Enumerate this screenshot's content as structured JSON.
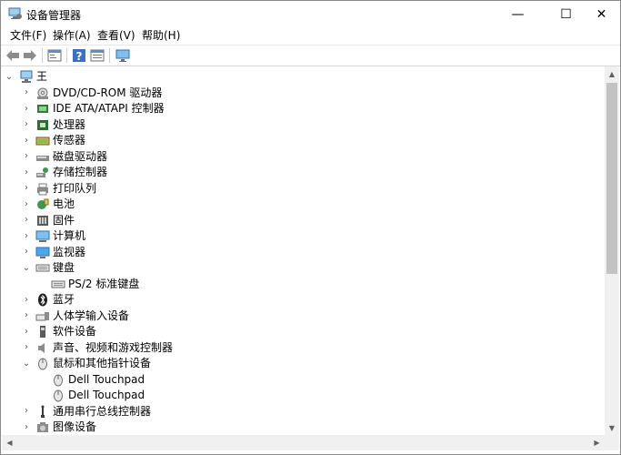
{
  "window": {
    "title": "设备管理器",
    "minimize": "—",
    "maximize": "☐",
    "close": "✕"
  },
  "menu": [
    "文件(F)",
    "操作(A)",
    "查看(V)",
    "帮助(H)"
  ],
  "toolbar": [
    "back-icon",
    "forward-icon",
    "properties-icon",
    "help-icon",
    "details-icon",
    "monitor-icon"
  ],
  "tree": {
    "root": "王",
    "items": [
      {
        "label": "DVD/CD-ROM 驱动器",
        "icon": "dvd-icon",
        "expanded": false,
        "level": 1
      },
      {
        "label": "IDE ATA/ATAPI 控制器",
        "icon": "ide-controller-icon",
        "expanded": false,
        "level": 1
      },
      {
        "label": "处理器",
        "icon": "processor-icon",
        "expanded": false,
        "level": 1
      },
      {
        "label": "传感器",
        "icon": "sensor-icon",
        "expanded": false,
        "level": 1
      },
      {
        "label": "磁盘驱动器",
        "icon": "disk-icon",
        "expanded": false,
        "level": 1
      },
      {
        "label": "存储控制器",
        "icon": "storage-icon",
        "expanded": false,
        "level": 1
      },
      {
        "label": "打印队列",
        "icon": "printer-icon",
        "expanded": false,
        "level": 1
      },
      {
        "label": "电池",
        "icon": "battery-icon",
        "expanded": false,
        "level": 1
      },
      {
        "label": "固件",
        "icon": "firmware-icon",
        "expanded": false,
        "level": 1
      },
      {
        "label": "计算机",
        "icon": "computer-icon",
        "expanded": false,
        "level": 1
      },
      {
        "label": "监视器",
        "icon": "monitor-icon",
        "expanded": false,
        "level": 1
      },
      {
        "label": "键盘",
        "icon": "keyboard-icon",
        "expanded": true,
        "level": 1
      },
      {
        "label": "PS/2 标准键盘",
        "icon": "keyboard-icon",
        "expanded": null,
        "level": 2
      },
      {
        "label": "蓝牙",
        "icon": "bluetooth-icon",
        "expanded": false,
        "level": 1
      },
      {
        "label": "人体学输入设备",
        "icon": "hid-icon",
        "expanded": false,
        "level": 1
      },
      {
        "label": "软件设备",
        "icon": "software-device-icon",
        "expanded": false,
        "level": 1
      },
      {
        "label": "声音、视频和游戏控制器",
        "icon": "speaker-icon",
        "expanded": false,
        "level": 1
      },
      {
        "label": "鼠标和其他指针设备",
        "icon": "mouse-icon",
        "expanded": true,
        "level": 1
      },
      {
        "label": "Dell Touchpad",
        "icon": "mouse-icon",
        "expanded": null,
        "level": 2
      },
      {
        "label": "Dell Touchpad",
        "icon": "mouse-icon",
        "expanded": null,
        "level": 2
      },
      {
        "label": "通用串行总线控制器",
        "icon": "usb-icon",
        "expanded": false,
        "level": 1
      },
      {
        "label": "图像设备",
        "icon": "camera-icon",
        "expanded": false,
        "level": 1
      }
    ]
  },
  "colors": {
    "accent": "#0078d7",
    "scroll_thumb": "#c2c2c2",
    "scroll_track": "#f0f0f0"
  }
}
